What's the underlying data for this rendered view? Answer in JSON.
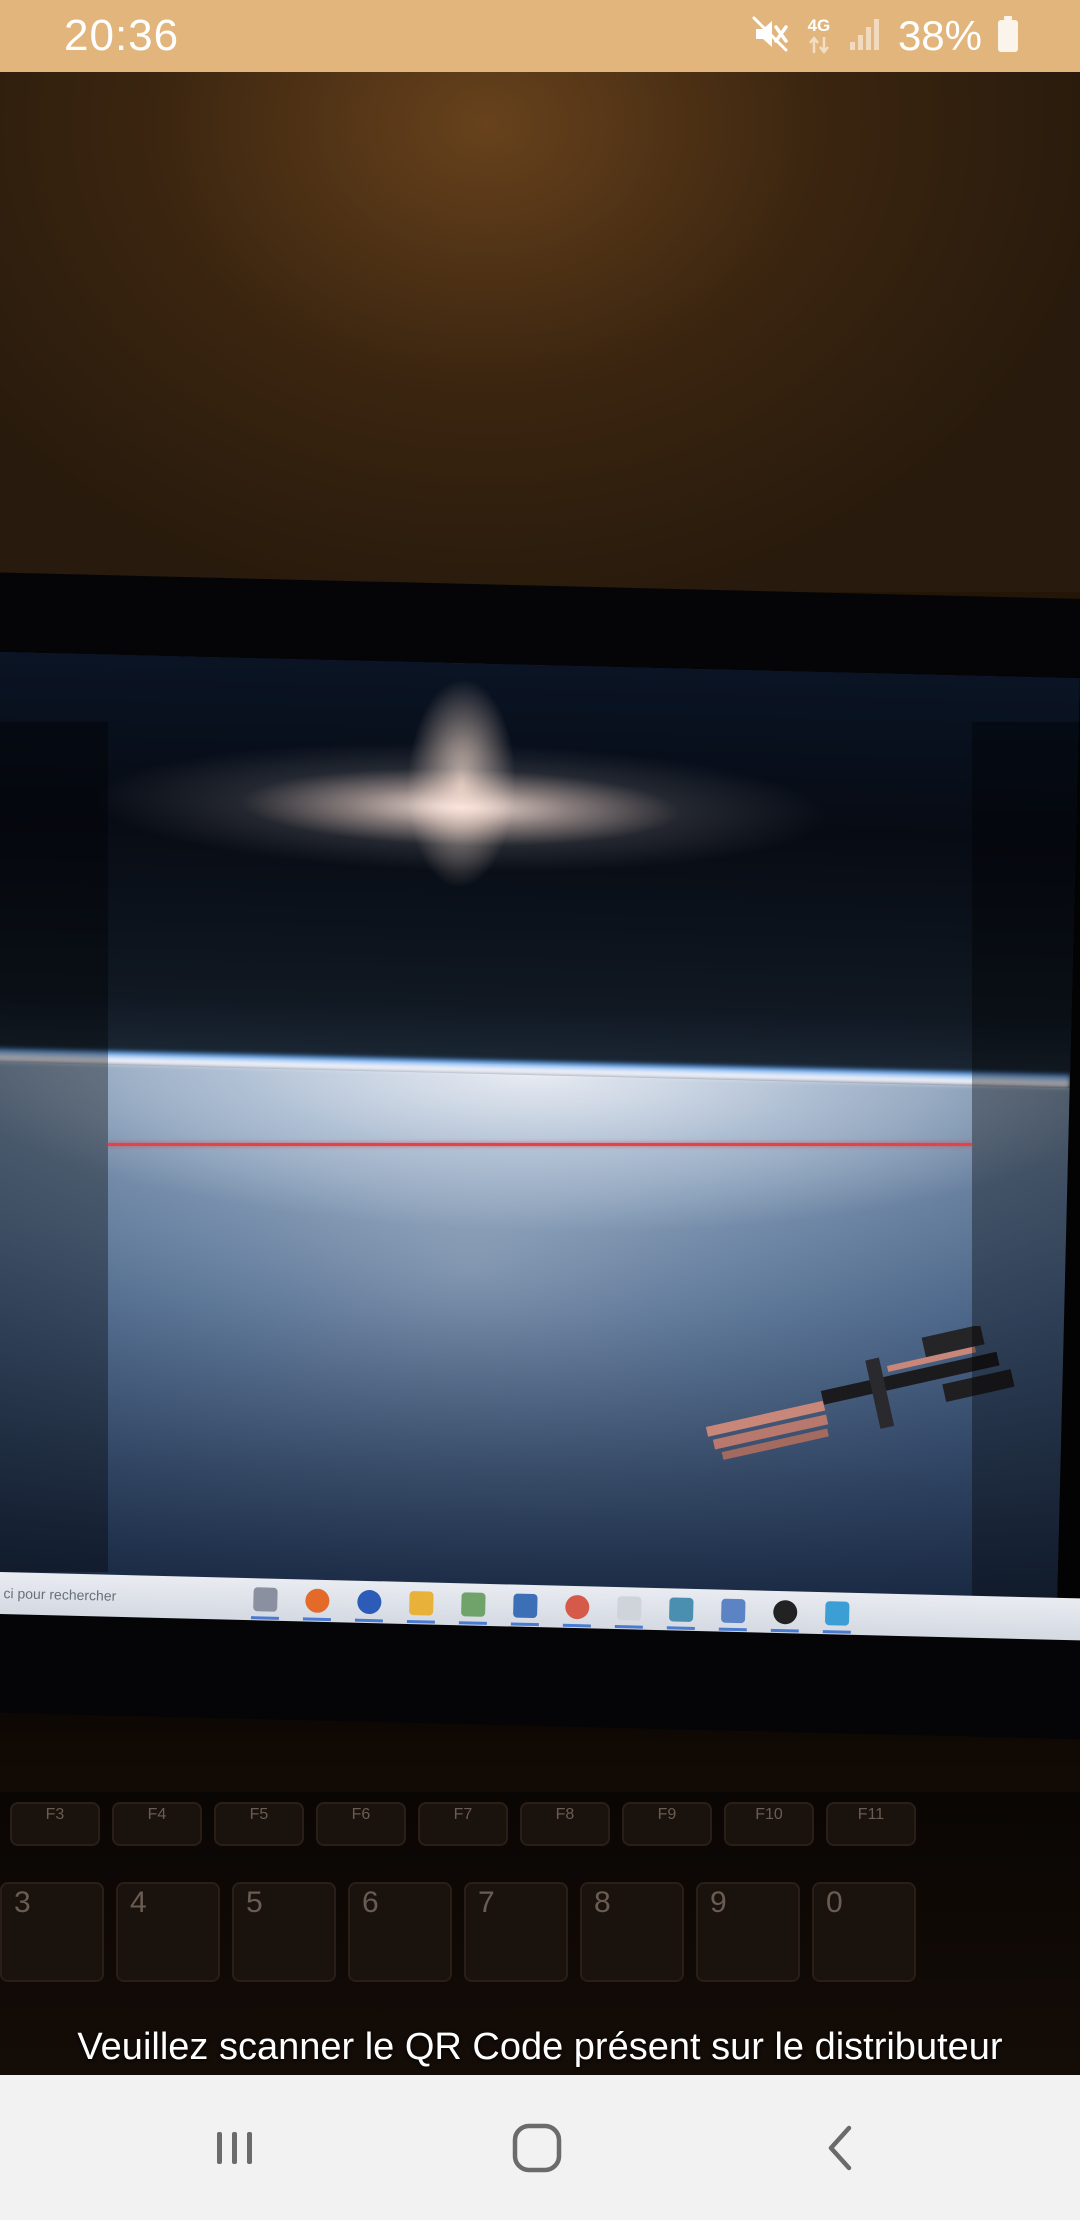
{
  "status_bar": {
    "time": "20:36",
    "network": "4G",
    "battery_percent": "38%",
    "icons": [
      "mute-icon",
      "network-4g-icon",
      "signal-icon",
      "battery-icon"
    ]
  },
  "scanner": {
    "instruction": "Veuillez scanner le QR Code présent sur le distributeur",
    "scan_line_color": "#e0444a"
  },
  "camera_feed": {
    "taskbar_search_text": "ci pour rechercher",
    "keyboard_rows": [
      [
        "F3",
        "F4",
        "F5",
        "F6",
        "F7",
        "F8",
        "F9",
        "F10",
        "F11"
      ],
      [
        "3",
        "4",
        "5",
        "6",
        "7",
        "8",
        "9",
        "0"
      ]
    ]
  },
  "navigation_bar": {
    "buttons": [
      "recents-icon",
      "home-icon",
      "back-icon"
    ],
    "background": "#f2f2f2",
    "icon_color": "#6b6b6b"
  },
  "colors": {
    "status_bar_bg": "#e2b57c",
    "status_text": "#ffffff"
  }
}
